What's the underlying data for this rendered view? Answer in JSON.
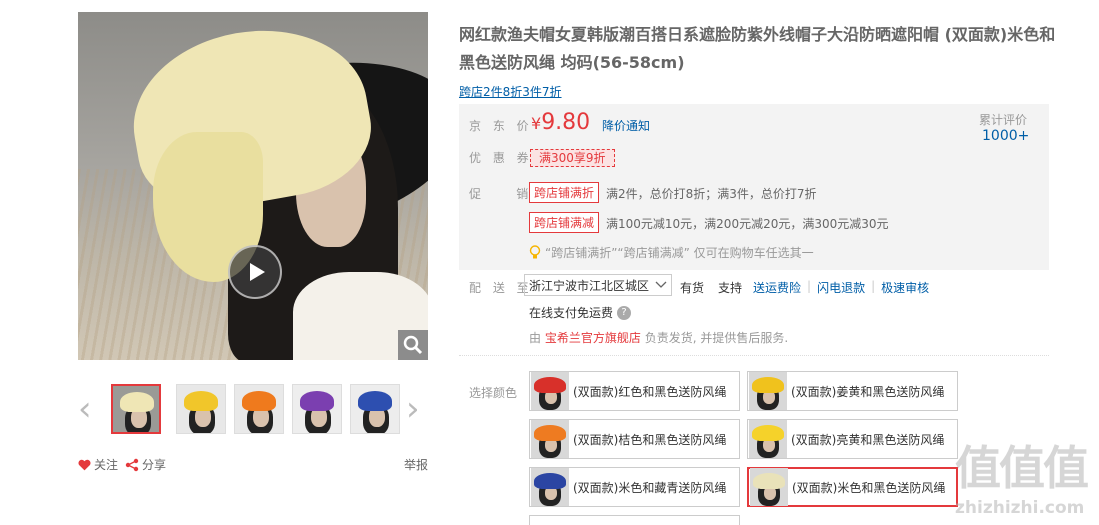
{
  "product": {
    "title": "网红款渔夫帽女夏韩版潮百搭日系遮脸防紫外线帽子大沿防晒遮阳帽 (双面款)米色和黑色送防风绳 均码(56-58cm)",
    "promo_link": "跨店2件8折3件7折"
  },
  "gallery": {
    "thumbs": [
      {
        "hat": "#efe6b5",
        "bg": "#9a9a96"
      },
      {
        "hat": "#f1c62a",
        "bg": "#e8e8e8"
      },
      {
        "hat": "#ef7a1d",
        "bg": "#e9e9e9"
      },
      {
        "hat": "#7b3fb0",
        "bg": "#eeeeee"
      },
      {
        "hat": "#2d4fb0",
        "bg": "#ededed"
      }
    ],
    "follow_label": "关注",
    "share_label": "分享",
    "report_label": "举报"
  },
  "price": {
    "label": "京 东 价",
    "currency": "¥",
    "value": "9.80",
    "notify": "降价通知",
    "review_label": "累计评价",
    "review_count": "1000+"
  },
  "coupon": {
    "label": "优 惠 券",
    "tag": "满300享9折"
  },
  "promotion": {
    "label": "促    销",
    "items": [
      {
        "tag": "跨店铺满折",
        "text": "满2件，总价打8折；满3件，总价打7折"
      },
      {
        "tag": "跨店铺满减",
        "text": "满100元减10元，满200元减20元，满300元减30元"
      }
    ],
    "note": "“跨店铺满折”“跨店铺满减” 仅可在购物车任选其一"
  },
  "delivery": {
    "label": "配 送 至",
    "address": "浙江宁波市江北区城区",
    "stock": "有货",
    "support": "支持",
    "services": [
      "送运费险",
      "闪电退款",
      "极速审核"
    ],
    "free_shipping": "在线支付免运费",
    "seller_prefix": "由",
    "seller": "宝希兰官方旗舰店",
    "seller_suffix": "负责发货, 并提供售后服务."
  },
  "colors": {
    "label": "选择颜色",
    "items": [
      {
        "name": "(双面款)红色和黑色送防风绳",
        "swatch": "#d8302a"
      },
      {
        "name": "(双面款)姜黄和黑色送防风绳",
        "swatch": "#f0c21d"
      },
      {
        "name": "(双面款)桔色和黑色送防风绳",
        "swatch": "#ee7b21"
      },
      {
        "name": "(双面款)亮黄和黑色送防风绳",
        "swatch": "#f5d22a"
      },
      {
        "name": "(双面款)米色和藏青送防风绳",
        "swatch": "#2b45a3"
      },
      {
        "name": "(双面款)米色和黑色送防风绳",
        "swatch": "#e9e2b9"
      }
    ]
  },
  "watermark": {
    "big": "值值值",
    "small": "zhizhizhi.com"
  }
}
